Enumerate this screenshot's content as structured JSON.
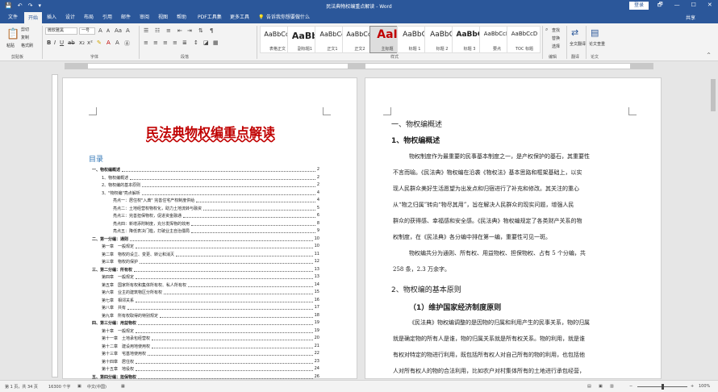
{
  "titlebar": {
    "title": "民法典物权编重点解读 - Word",
    "login": "登录",
    "qat": [
      "💾",
      "↶",
      "↷",
      "▾"
    ],
    "win": [
      "🗗",
      "—",
      "☐",
      "✕"
    ]
  },
  "tabs": {
    "items": [
      "文件",
      "开始",
      "插入",
      "设计",
      "布局",
      "引用",
      "邮件",
      "审阅",
      "视图",
      "帮助",
      "PDF工具集",
      "更多工具"
    ],
    "tell_me": "告诉我你想要做什么",
    "share": "共享"
  },
  "ribbon": {
    "clipboard": {
      "paste": "粘贴",
      "cut": "剪切",
      "copy": "复制",
      "format_painter": "格式刷",
      "label": "剪贴板"
    },
    "font": {
      "name": "微软雅黑",
      "size": "一号",
      "label": "字体"
    },
    "paragraph": {
      "label": "段落"
    },
    "styles": {
      "label": "样式",
      "items": [
        {
          "sample": "AaBbCcI",
          "name": "表格正文"
        },
        {
          "sample": "AaBb",
          "name": "副标题1"
        },
        {
          "sample": "AaBbCc",
          "name": "正文1"
        },
        {
          "sample": "AaBbCcI",
          "name": "正文2"
        },
        {
          "sample": "AaI",
          "name": "主标题"
        },
        {
          "sample": "AaBbC",
          "name": "标题 1"
        },
        {
          "sample": "AaBbC",
          "name": "标题 2"
        },
        {
          "sample": "AaBbC",
          "name": "标题 3"
        },
        {
          "sample": "AaBbCcD",
          "name": "要点"
        },
        {
          "sample": "AaBbCcD",
          "name": "TOC 标题"
        }
      ]
    },
    "editing": {
      "find": "查找",
      "replace": "替换",
      "select": "选择",
      "label": "编辑"
    },
    "translate": {
      "label": "全文翻译",
      "group": "翻译"
    },
    "paper": {
      "label": "论文查重",
      "group": "论文"
    }
  },
  "page1": {
    "title": "民法典物权编重点解读",
    "toc_heading": "目录",
    "toc": [
      {
        "text": "一、物权编概述",
        "page": "2",
        "bold": true,
        "indent": 0
      },
      {
        "text": "1、物权编概述",
        "page": "2",
        "bold": false,
        "indent": 1
      },
      {
        "text": "2、物权编的基本原则",
        "page": "2",
        "bold": false,
        "indent": 1
      },
      {
        "text": "3、\"物权编\"亮点解析",
        "page": "4",
        "bold": false,
        "indent": 1
      },
      {
        "text": "亮点一：居住权\"入典\" 完善住宅产权制度供给",
        "page": "4",
        "bold": false,
        "indent": 2
      },
      {
        "text": "亮点二：土地经营权物权化，助力土地流转与融资",
        "page": "5",
        "bold": false,
        "indent": 2
      },
      {
        "text": "亮点三：完善担保物权，促进资金融通",
        "page": "6",
        "bold": false,
        "indent": 2
      },
      {
        "text": "亮点四：新增添附制度，充分发挥物的效用",
        "page": "8",
        "bold": false,
        "indent": 2
      },
      {
        "text": "亮点五：降低表决门槛，打破业主自治僵局",
        "page": "9",
        "bold": false,
        "indent": 2
      },
      {
        "text": "二、第一分编：通则",
        "page": "10",
        "bold": true,
        "indent": 0
      },
      {
        "text": "第一章　一般规定",
        "page": "10",
        "bold": false,
        "indent": 1
      },
      {
        "text": "第二章　物权的设立、变更、转让和消灭",
        "page": "11",
        "bold": false,
        "indent": 1
      },
      {
        "text": "第三章　物权的保护",
        "page": "12",
        "bold": false,
        "indent": 1
      },
      {
        "text": "三、第二分编：所有权",
        "page": "13",
        "bold": true,
        "indent": 0
      },
      {
        "text": "第四章　一般规定",
        "page": "13",
        "bold": false,
        "indent": 1
      },
      {
        "text": "第五章　国家所有权和集体所有权、私人所有权",
        "page": "14",
        "bold": false,
        "indent": 1
      },
      {
        "text": "第六章　业主的建筑物区分所有权",
        "page": "15",
        "bold": false,
        "indent": 1
      },
      {
        "text": "第七章　相邻关系",
        "page": "16",
        "bold": false,
        "indent": 1
      },
      {
        "text": "第八章　共有",
        "page": "17",
        "bold": false,
        "indent": 1
      },
      {
        "text": "第九章　所有权取得的特别规定",
        "page": "18",
        "bold": false,
        "indent": 1
      },
      {
        "text": "四、第三分编：用益物权",
        "page": "19",
        "bold": true,
        "indent": 0
      },
      {
        "text": "第十章　一般规定",
        "page": "19",
        "bold": false,
        "indent": 1
      },
      {
        "text": "第十一章　土地承包经营权",
        "page": "20",
        "bold": false,
        "indent": 1
      },
      {
        "text": "第十二章　建设用地使用权",
        "page": "21",
        "bold": false,
        "indent": 1
      },
      {
        "text": "第十三章　宅基地使用权",
        "page": "22",
        "bold": false,
        "indent": 1
      },
      {
        "text": "第十四章　居住权",
        "page": "23",
        "bold": false,
        "indent": 1
      },
      {
        "text": "第十五章　地役权",
        "page": "24",
        "bold": false,
        "indent": 1
      },
      {
        "text": "五、第四分编：担保物权",
        "page": "26",
        "bold": true,
        "indent": 0
      }
    ]
  },
  "page2": {
    "h1": "一、物权编概述",
    "h1_1": "1、物权编概述",
    "para1": [
      "物权制度作为最重要的民事基本制度之一，是产权保护的基石，其重要性",
      "不言而喻。《民法典》物权编在沿袭《物权法》基本思路和框架基础上，以实",
      "现人民群众美好生活愿望为出发点和归宿进行了补充和修改。其关注的重心",
      "从“物之归属”转向“物尽其用”，旨在解决人民群众的现实问题，增强人民",
      "群众的获得感、幸福感和安全感。《民法典》物权编规定了各类财产关系的物",
      "权制度，在《民法典》各分编中排在第一编，重要性可见一斑。"
    ],
    "para2": [
      "物权编共分为通则、所有权、用益物权、担保物权、占有 5 个分编，共",
      "258 条，2.3 万余字。"
    ],
    "h1_2": "2、物权编的基本原则",
    "h3": "（1）维护国家经济制度原则",
    "para3": [
      "《民法典》物权编调整的是因物的归属和利用产生的民事关系，物的归属",
      "就是确定物的所有人是谁，物的归属关系就是所有权关系。物的利用，就是谁",
      "有权对特定的物进行利用，既包括所有权人对自己所有的物的利用，也包括他",
      "人对所有权人的物的合法利用，比如农户对村集体所有的土地进行承包经营，"
    ]
  },
  "statusbar": {
    "page": "第 1 页，共 34 页",
    "words": "16300 个字",
    "lang": "中文(中国)",
    "zoom": "100%"
  }
}
